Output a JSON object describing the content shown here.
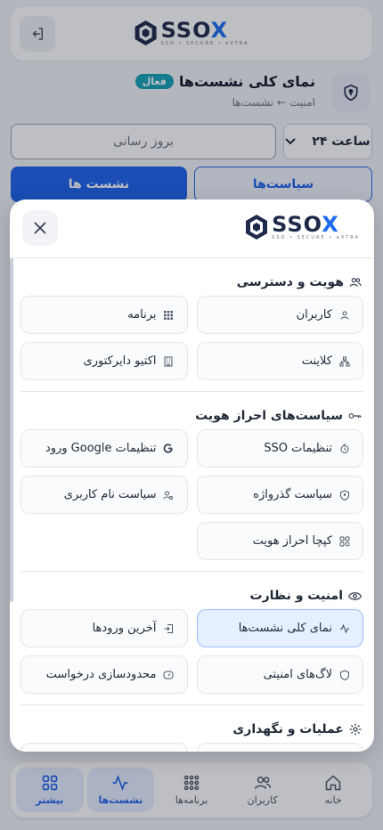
{
  "brand": {
    "name": "SSO",
    "name_x": "X",
    "tagline": "SSO • SECURE • eXTRA"
  },
  "header": {
    "logout_icon": "logout-icon"
  },
  "page": {
    "title": "نمای کلی نشست‌ها",
    "badge": "فعال",
    "breadcrumb_parent": "امنیت",
    "breadcrumb_sep": "←",
    "breadcrumb_current": "نشست‌ها"
  },
  "controls": {
    "refresh_label": "بروز رسانی",
    "range_label": "۲۴ ساعت"
  },
  "tabs": {
    "sessions": "نشست ها",
    "policies": "سیاست‌ها"
  },
  "menu": {
    "sections": [
      {
        "title": "هویت و دسترسی",
        "icon": "users-icon",
        "items": [
          {
            "label": "کاربران",
            "icon": "user-icon"
          },
          {
            "label": "برنامه",
            "icon": "apps-grid-icon"
          },
          {
            "label": "کلاینت",
            "icon": "network-icon"
          },
          {
            "label": "اکتیو دایرکتوری",
            "icon": "building-icon"
          }
        ]
      },
      {
        "title": "سیاست‌های احراز هویت",
        "icon": "key-icon",
        "items": [
          {
            "label": "تنظیمات SSO",
            "icon": "timer-icon"
          },
          {
            "label": "تنظیمات Google ورود",
            "icon": "google-icon"
          },
          {
            "label": "سیاست گذرواژه",
            "icon": "shield-icon"
          },
          {
            "label": "سیاست نام کاربری",
            "icon": "user-gear-icon"
          },
          {
            "label": "کپچا احراز هویت",
            "icon": "captcha-icon"
          }
        ]
      },
      {
        "title": "امنیت و نظارت",
        "icon": "eye-icon",
        "items": [
          {
            "label": "نمای کلی نشست‌ها",
            "icon": "activity-icon",
            "selected": true
          },
          {
            "label": "آخرین ورودها",
            "icon": "login-icon"
          },
          {
            "label": "لاگ‌های امنیتی",
            "icon": "shield-icon"
          },
          {
            "label": "محدودسازی درخواست",
            "icon": "gauge-icon"
          }
        ]
      },
      {
        "title": "عملیات و نگهداری",
        "icon": "gear-icon",
        "items": []
      }
    ]
  },
  "bottom_nav": [
    {
      "label": "خانه",
      "icon": "home-icon"
    },
    {
      "label": "کاربران",
      "icon": "users-icon"
    },
    {
      "label": "برنامه‌ها",
      "icon": "apps-grid-icon"
    },
    {
      "label": "نشست‌ها",
      "icon": "activity-icon",
      "selected": true
    },
    {
      "label": "بیشتر",
      "icon": "grid-icon",
      "selected": true
    }
  ],
  "colors": {
    "primary": "#1d63ec",
    "badge": "#16a3b8",
    "selected_bg": "#e6efff"
  }
}
